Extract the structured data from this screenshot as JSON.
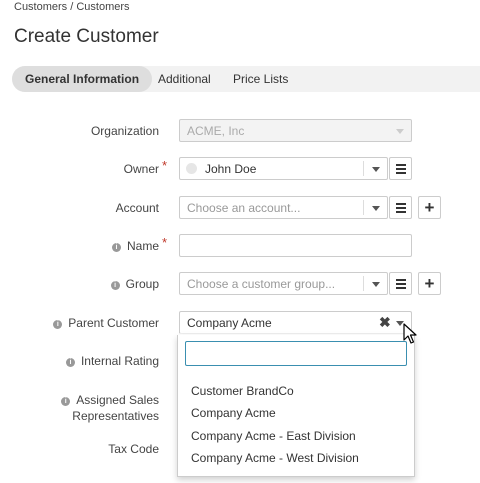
{
  "breadcrumb": "Customers / Customers",
  "page_title": "Create Customer",
  "tabs": [
    {
      "label": "General Information",
      "active": true
    },
    {
      "label": "Additional",
      "active": false
    },
    {
      "label": "Price Lists",
      "active": false
    }
  ],
  "form": {
    "organization": {
      "label": "Organization",
      "value": "ACME, Inc",
      "disabled": true
    },
    "owner": {
      "label": "Owner",
      "required_mark": "*",
      "value": "John Doe"
    },
    "account": {
      "label": "Account",
      "placeholder": "Choose an account..."
    },
    "name": {
      "label": "Name",
      "required_mark": "*",
      "value": ""
    },
    "group": {
      "label": "Group",
      "placeholder": "Choose a customer group..."
    },
    "parent_customer": {
      "label": "Parent Customer",
      "value": "Company Acme"
    },
    "internal_rating": {
      "label": "Internal Rating"
    },
    "assigned_sales": {
      "label_line1": "Assigned Sales",
      "label_line2": "Representatives"
    },
    "tax_code": {
      "label": "Tax Code"
    }
  },
  "dropdown": {
    "search_value": "",
    "options": [
      "Customer BrandCo",
      "Company Acme",
      "Company Acme - East Division",
      "Company Acme - West Division"
    ]
  },
  "colors": {
    "accent": "#3a8fb0",
    "required": "#c0392b"
  }
}
